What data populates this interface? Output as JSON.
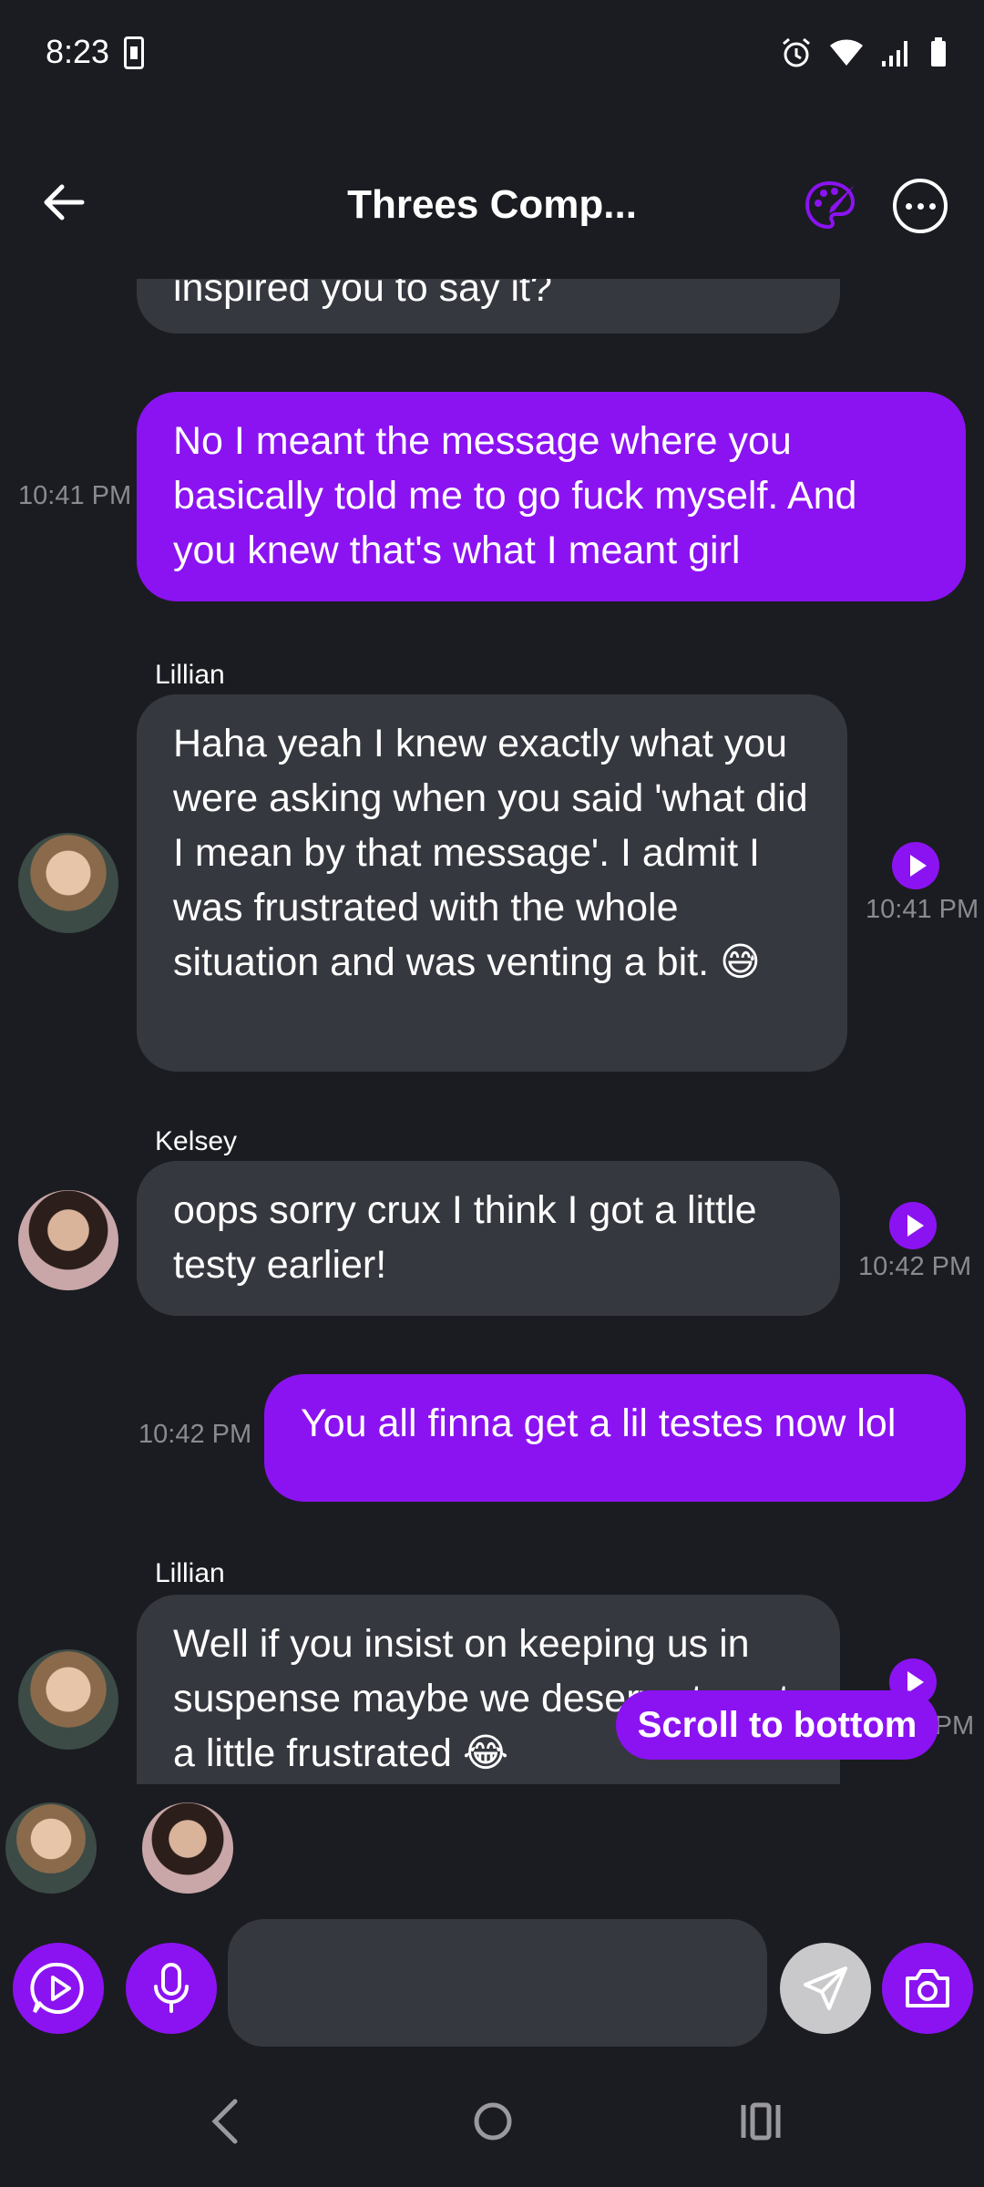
{
  "status_bar": {
    "time": "8:23"
  },
  "header": {
    "title": "Threes Comp..."
  },
  "messages": [
    {
      "side": "in",
      "sender": "",
      "text": "inspired you to say it?",
      "time": ""
    },
    {
      "side": "out",
      "text": "No I meant the message where you basically told me to go fuck myself. And you knew that's what I meant girl",
      "time": "10:41 PM"
    },
    {
      "side": "in",
      "sender": "Lillian",
      "text": "Haha yeah I knew exactly what you were asking when you said 'what did I mean by that message'. I admit I was frustrated with the whole situation and was venting a bit. 😅",
      "time": "10:41 PM"
    },
    {
      "side": "in",
      "sender": "Kelsey",
      "text": "oops sorry crux I think I got a little testy earlier!",
      "time": "10:42 PM"
    },
    {
      "side": "out",
      "text": "You all finna get a lil testes now lol",
      "time": "10:42 PM"
    },
    {
      "side": "in",
      "sender": "Lillian",
      "text": "Well if you insist on keeping us in suspense maybe we deserve to get a little frustrated 😂",
      "time": "10:43 PM"
    }
  ],
  "scroll_to_bottom_label": "Scroll to bottom",
  "participants": [
    "Lillian",
    "Kelsey"
  ],
  "colors": {
    "accent": "#8b13f2",
    "background": "#1b1c21",
    "incoming_bubble": "#36383f"
  }
}
